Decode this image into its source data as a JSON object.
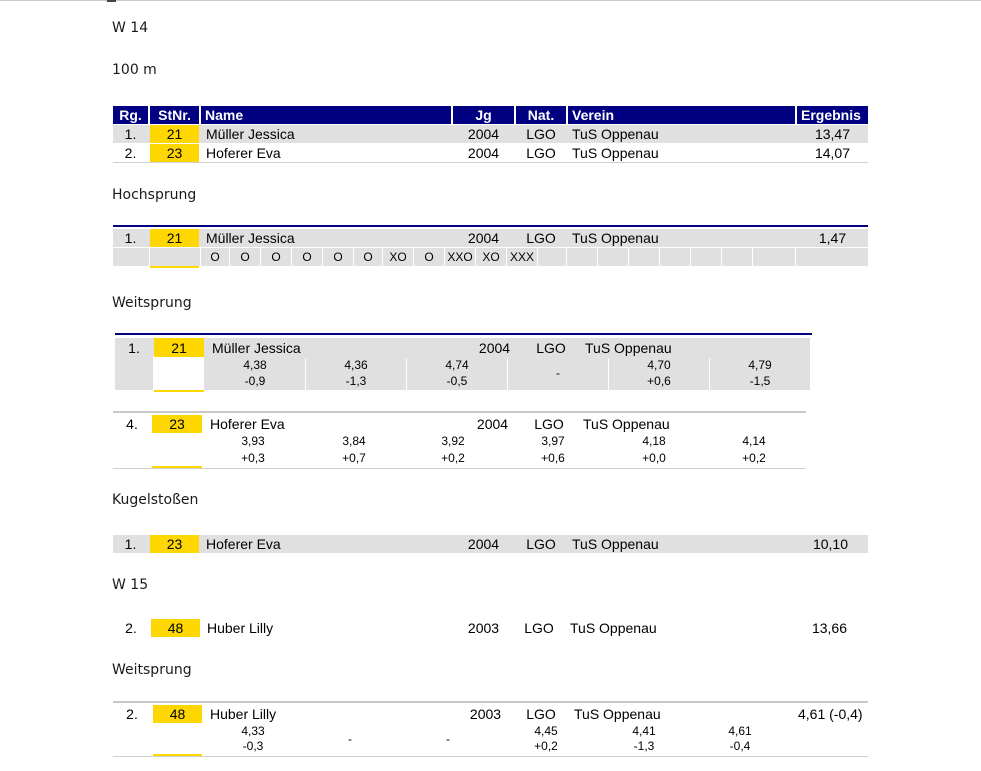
{
  "headers": {
    "rank": "Rg.",
    "bib": "StNr.",
    "name": "Name",
    "year": "Jg",
    "nat": "Nat.",
    "club": "Verein",
    "result": "Ergebnis"
  },
  "colors": {
    "header_bg": "#000080",
    "bib_bg": "#ffd700",
    "row_bg": "#e0e0e0"
  },
  "sections": {
    "w14": {
      "title": "W 14",
      "sprint": {
        "title": "100 m",
        "rows": [
          {
            "rank": "1.",
            "bib": "21",
            "name": "Müller Jessica",
            "year": "2004",
            "nat": "LGO",
            "club": "TuS Oppenau",
            "result": "13,47"
          },
          {
            "rank": "2.",
            "bib": "23",
            "name": "Hoferer Eva",
            "year": "2004",
            "nat": "LGO",
            "club": "TuS Oppenau",
            "result": "14,07"
          }
        ]
      },
      "highjump": {
        "title": "Hochsprung",
        "row": {
          "rank": "1.",
          "bib": "21",
          "name": "Müller Jessica",
          "year": "2004",
          "nat": "LGO",
          "club": "TuS Oppenau",
          "result": "1,47"
        },
        "attempts": [
          "O",
          "O",
          "O",
          "O",
          "O",
          "O",
          "XO",
          "O",
          "XXO",
          "XO",
          "XXX"
        ]
      },
      "longjump": {
        "title": "Weitsprung",
        "row1": {
          "rank": "1.",
          "bib": "21",
          "name": "Müller Jessica",
          "year": "2004",
          "nat": "LGO",
          "club": "TuS Oppenau",
          "attempts": [
            {
              "dist": "4,38",
              "wind": "-0,9"
            },
            {
              "dist": "4,36",
              "wind": "-1,3"
            },
            {
              "dist": "4,74",
              "wind": "-0,5"
            },
            {
              "dist": "-",
              "wind": ""
            },
            {
              "dist": "4,70",
              "wind": "+0,6"
            },
            {
              "dist": "4,79",
              "wind": "-1,5"
            }
          ]
        },
        "row2": {
          "rank": "4.",
          "bib": "23",
          "name": "Hoferer Eva",
          "year": "2004",
          "nat": "LGO",
          "club": "TuS Oppenau",
          "attempts": [
            {
              "dist": "3,93",
              "wind": "+0,3"
            },
            {
              "dist": "3,84",
              "wind": "+0,7"
            },
            {
              "dist": "3,92",
              "wind": "+0,2"
            },
            {
              "dist": "3,97",
              "wind": "+0,6"
            },
            {
              "dist": "4,18",
              "wind": "+0,0"
            },
            {
              "dist": "4,14",
              "wind": "+0,2"
            }
          ]
        }
      },
      "shotput": {
        "title": "Kugelstoßen",
        "row": {
          "rank": "1.",
          "bib": "23",
          "name": "Hoferer Eva",
          "year": "2004",
          "nat": "LGO",
          "club": "TuS Oppenau",
          "result": "10,10"
        }
      }
    },
    "w15": {
      "title": "W 15",
      "row": {
        "rank": "2.",
        "bib": "48",
        "name": "Huber Lilly",
        "year": "2003",
        "nat": "LGO",
        "club": "TuS Oppenau",
        "result": "13,66"
      },
      "longjump": {
        "title": "Weitsprung",
        "row": {
          "rank": "2.",
          "bib": "48",
          "name": "Huber Lilly",
          "year": "2003",
          "nat": "LGO",
          "club": "TuS Oppenau",
          "result": "4,61 (-0,4)",
          "attempts": [
            {
              "dist": "4,33",
              "wind": "-0,3"
            },
            {
              "dist": "-",
              "wind": ""
            },
            {
              "dist": "-",
              "wind": ""
            },
            {
              "dist": "4,45",
              "wind": "+0,2"
            },
            {
              "dist": "4,41",
              "wind": "-1,3"
            },
            {
              "dist": "4,61",
              "wind": "-0,4"
            }
          ]
        }
      }
    }
  }
}
